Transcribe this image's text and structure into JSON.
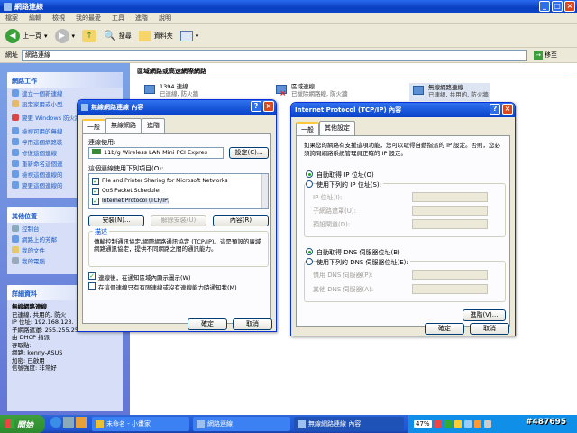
{
  "explorer": {
    "title": "網路連線",
    "menu": [
      "檔案",
      "編輯",
      "檢視",
      "我的最愛",
      "工具",
      "進階",
      "說明"
    ],
    "toolbar": {
      "back": "上一頁",
      "search": "搜尋",
      "folders": "資料夾"
    },
    "address_label": "網址",
    "address_value": "網路連線",
    "go": "移至"
  },
  "leftpane": {
    "network_tasks_title": "網路工作",
    "network_tasks": [
      "建立一個新連線",
      "設定家用或小型",
      "變更 Windows 防火牆設定",
      "檢視可用的無線",
      "停用這個網路裝",
      "修復這個連線",
      "重新命名這個連",
      "檢視這個連線的",
      "變更這個連線的"
    ],
    "other_places_title": "其他位置",
    "other_places": [
      "控制台",
      "網路上的芳鄰",
      "我的文件",
      "我的電腦"
    ],
    "details_title": "詳細資料",
    "details_name": "無線網路連線",
    "details_lines": [
      "已連線, 共用的, 防火",
      "IP 位址: 192.168.123.",
      "子網路遮罩: 255.255.255.0",
      "由 DHCP 指派",
      "存取點:",
      "網路: kenny-ASUS",
      "加密: 已啟用",
      "信號強度: 非常好"
    ]
  },
  "content": {
    "section_title": "區域網路或高速網際網路",
    "conn1394": {
      "name": "1394 連線",
      "status": "已連線, 防火牆"
    },
    "conn_lan": {
      "name": "區域連線",
      "status": "已拔除網路線, 防火牆"
    },
    "conn_wifi": {
      "name": "無線網路連線",
      "status": "已連線, 共用的, 防火牆"
    }
  },
  "wireless_dialog": {
    "title": "無線網路連線 內容",
    "tabs": [
      "一般",
      "無線網路",
      "進階"
    ],
    "connect_using_label": "連線使用:",
    "adapter": "11b/g Wireless LAN Mini PCI Expres",
    "configure_button": "設定(C)...",
    "items_label": "這個連線使用下列項目(O):",
    "items": [
      "File and Printer Sharing for Microsoft Networks",
      "QoS Packet Scheduler",
      "Internet Protocol (TCP/IP)"
    ],
    "install_button": "安裝(N)...",
    "uninstall_button": "解除安裝(U)",
    "properties_button": "內容(R)",
    "description_label": "描述",
    "description_text": "傳輸控制通訊協定/網際網路通訊協定 (TCP/IP)。這是預設的廣域網路通訊協定，提供不同網路之間的通訊能力。",
    "show_icon_check": "連線後，在通知區域內顯示圖示(W)",
    "notify_check": "在這個連線只有有限連線或沒有連線能力時通知我(M)",
    "ok": "確定",
    "cancel": "取消"
  },
  "tcpip_dialog": {
    "title": "Internet Protocol (TCP/IP) 內容",
    "tabs": [
      "一般",
      "其他設定"
    ],
    "intro": "如果您的網路有支援這項功能，您可以取得自動指派的 IP 設定。否則，您必須詢問網路系統管理員正確的 IP 設定。",
    "auto_ip": "自動取得 IP 位址(O)",
    "manual_ip": "使用下列的 IP 位址(S):",
    "ip_label": "IP 位址(I):",
    "mask_label": "子網路遮罩(U):",
    "gateway_label": "預設閘道(D):",
    "auto_dns": "自動取得 DNS 伺服器位址(B)",
    "manual_dns": "使用下列的 DNS 伺服器位址(E):",
    "preferred_dns": "慣用 DNS 伺服器(P):",
    "alternate_dns": "其他 DNS 伺服器(A):",
    "advanced_button": "進階(V)...",
    "ok": "確定",
    "cancel": "取消"
  },
  "taskbar": {
    "start": "開始",
    "tasks": [
      "未命名 - 小畫家",
      "網路連線",
      "無線網路連線 內容"
    ],
    "battery": "47%",
    "watermark": "#487695"
  },
  "colors": {
    "xp_blue": "#0842c8",
    "start_green": "#3c9f3c",
    "close_red": "#d8491e"
  }
}
